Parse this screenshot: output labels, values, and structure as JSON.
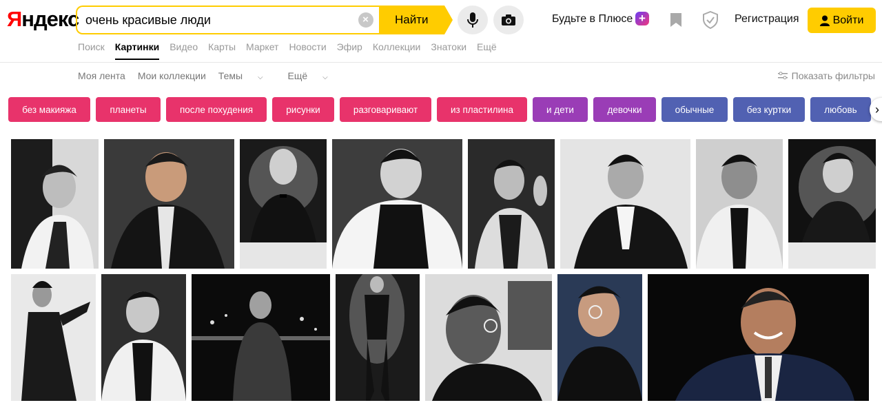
{
  "header": {
    "logo_first": "Я",
    "logo_rest": "ндекс",
    "search_value": "очень красивые люди",
    "find_label": "Найти",
    "plus_label": "Будьте в Плюсе",
    "register_label": "Регистрация",
    "login_label": "Войти"
  },
  "services": [
    "Поиск",
    "Картинки",
    "Видео",
    "Карты",
    "Маркет",
    "Новости",
    "Эфир",
    "Коллекции",
    "Знатоки",
    "Ещё"
  ],
  "subnav": {
    "feed": "Моя лента",
    "collections": "Мои коллекции",
    "themes": "Темы",
    "more": "Ещё",
    "filters": "Показать фильтры"
  },
  "chips": [
    {
      "label": "без макияжа",
      "color": "#e8336b"
    },
    {
      "label": "планеты",
      "color": "#e8336b"
    },
    {
      "label": "после похудения",
      "color": "#e8336b"
    },
    {
      "label": "рисунки",
      "color": "#e8336b"
    },
    {
      "label": "разговаривают",
      "color": "#e8336b"
    },
    {
      "label": "из пластилина",
      "color": "#e8336b"
    },
    {
      "label": "и дети",
      "color": "#9a3db6"
    },
    {
      "label": "девочки",
      "color": "#9a3db6"
    },
    {
      "label": "обычные",
      "color": "#5161b2"
    },
    {
      "label": "без куртки",
      "color": "#5161b2"
    },
    {
      "label": "любовь",
      "color": "#5161b2"
    }
  ],
  "colors": {
    "accent": "#ffcc00",
    "logo_red": "#ff0000"
  }
}
